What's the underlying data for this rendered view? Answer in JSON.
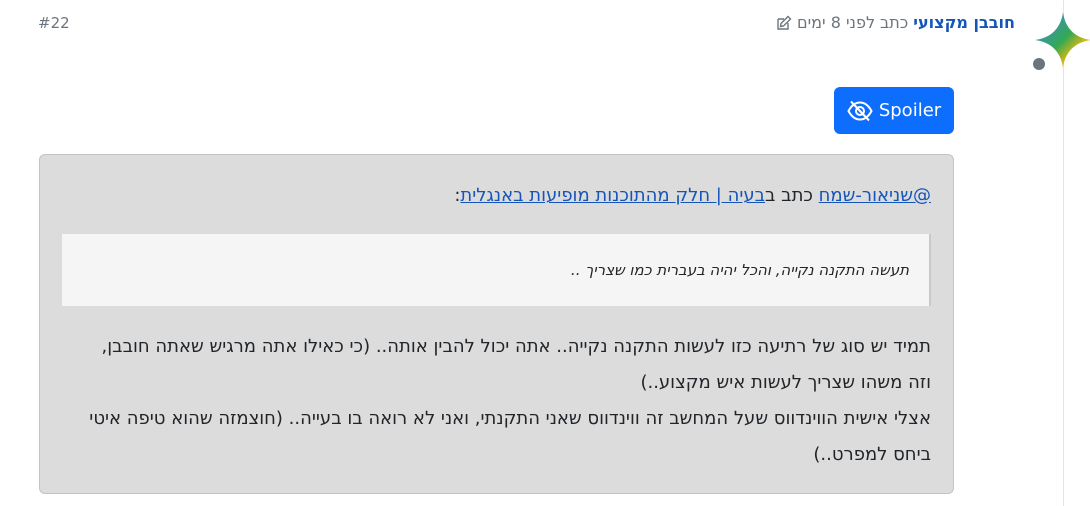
{
  "post": {
    "index": "#22",
    "author": "חובבן מקצועי",
    "wrote_prefix": "כתב",
    "time_ago": "לפני 8 ימים"
  },
  "spoiler": {
    "button_label": "Spoiler",
    "quote_header": {
      "mention": "@שניאור-שמח",
      "wrote": "כתב ב",
      "topic_link": "בעיה | חלק מהתוכנות מופיעות באנגלית",
      "colon": ":"
    },
    "blockquote_text": "תעשה התקנה נקייה, והכל יהיה בעברית כמו שצריך ..",
    "body_lines": [
      "תמיד יש סוג של רתיעה כזו לעשות התקנה נקייה.. אתה יכול להבין אותה.. (כי כאילו אתה מרגיש שאתה חובבן,",
      "וזה משהו שצריך לעשות איש מקצוע..)",
      "אצלי אישית הווינדווס שעל המחשב זה ווינדווס שאני התקנתי, ואני לא רואה בו בעייה.. (חוצמזה שהוא טיפה איטי",
      "ביחס למפרט..)"
    ]
  },
  "colors": {
    "link": "#1554b8",
    "button": "#0d6efd",
    "spoiler_bg": "#dcdcdc",
    "muted": "#6c757d"
  },
  "icons": {
    "avatar": "sparkle-avatar-icon",
    "edit": "edit-icon",
    "spoiler": "eye-slash-icon"
  }
}
